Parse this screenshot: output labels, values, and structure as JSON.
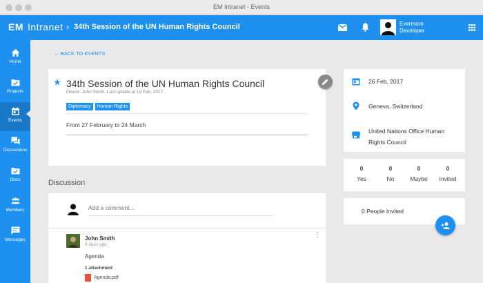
{
  "window": {
    "title": "EM Intranet - Events"
  },
  "appbar": {
    "brand_short": "EM",
    "brand_name": "Intranet",
    "breadcrumb": "34th Session of the UN Human Rights Council",
    "user_line1": "Evermore",
    "user_line2": "Developer",
    "accent": "#1e90ef"
  },
  "sidebar": {
    "items": [
      {
        "label": "Home",
        "icon": "home-icon"
      },
      {
        "label": "Projects",
        "icon": "folder-icon"
      },
      {
        "label": "Events",
        "icon": "calendar-icon",
        "active": true
      },
      {
        "label": "Discussions",
        "icon": "chat-icon"
      },
      {
        "label": "Docs",
        "icon": "docs-folder-icon"
      },
      {
        "label": "Members",
        "icon": "members-icon"
      },
      {
        "label": "Messages",
        "icon": "message-icon"
      }
    ]
  },
  "back_link": "BACK TO EVENTS",
  "event": {
    "title": "34th Session of the UN Human Rights Council",
    "owner": "Owner: John Smith, Last update at 19 Feb, 2017",
    "tags": [
      "Diplomacy",
      "Human Rights"
    ],
    "dates": "From 27 February to 24 March"
  },
  "discussion": {
    "heading": "Discussion",
    "comment_placeholder": "Add a comment...",
    "post": {
      "author": "John Smith",
      "time": "9 days ago",
      "body": "Agenda",
      "attachments_label": "1 attachment",
      "attachment_file": "Agenda.pdf"
    }
  },
  "info": {
    "date": "26 Feb, 2017",
    "location": "Geneva, Switzerland",
    "venue": "United Nations Office Human Rights Council"
  },
  "rsvp": [
    {
      "count": "0",
      "label": "Yes"
    },
    {
      "count": "0",
      "label": "No"
    },
    {
      "count": "0",
      "label": "Maybe"
    },
    {
      "count": "0",
      "label": "Invited"
    }
  ],
  "invited": "0 People Invited"
}
